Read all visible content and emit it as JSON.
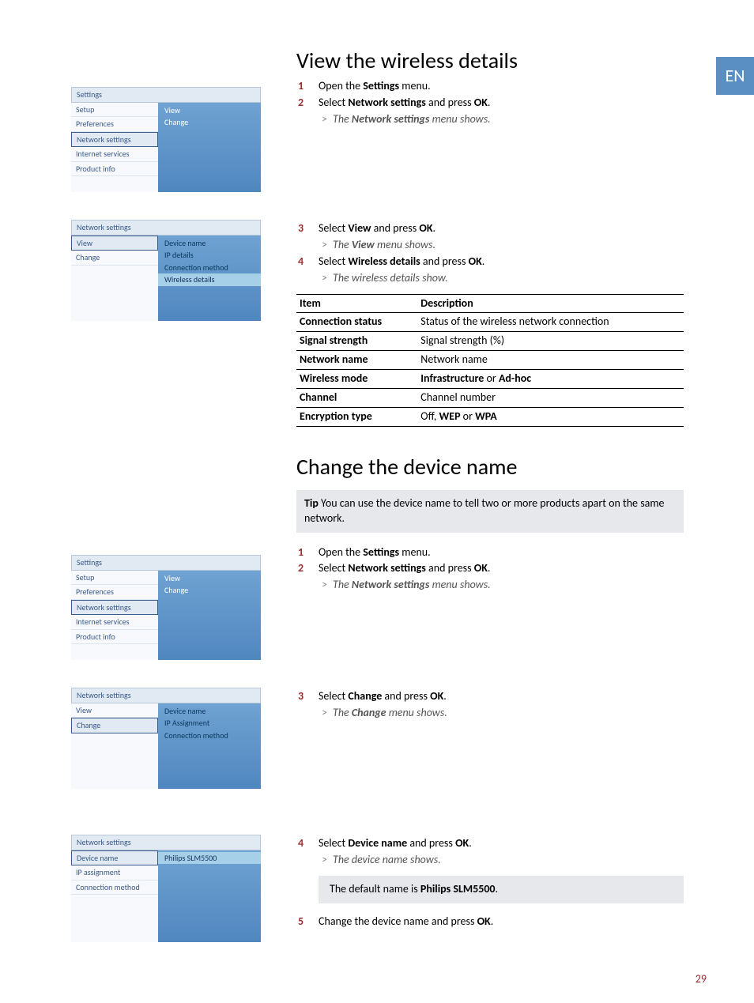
{
  "lang_tab": "EN",
  "page_number": "29",
  "section1": {
    "title": "View the wireless details",
    "steps": {
      "s1": "Open the Settings menu.",
      "s2a": "Select ",
      "s2b": "Network settings",
      "s2c": " and press ",
      "s2d": "OK",
      "s2e": ".",
      "r2a": "The ",
      "r2b": "Network settings",
      "r2c": " menu shows.",
      "s3a": "Select ",
      "s3b": "View",
      "s3c": " and press ",
      "s3d": "OK",
      "s3e": ".",
      "r3a": "The ",
      "r3b": "View",
      "r3c": " menu shows.",
      "s4a": "Select ",
      "s4b": "Wireless details",
      "s4c": " and press ",
      "s4d": "OK",
      "s4e": ".",
      "r4": "The wireless details show."
    },
    "table": {
      "h1": "Item",
      "h2": "Description",
      "rows": [
        {
          "a": "Connection status",
          "b": "Status of the wireless network connection",
          "abold": true
        },
        {
          "a": "Signal strength",
          "b": "Signal strength (%)",
          "abold": true
        },
        {
          "a": "Network name",
          "b": "Network name",
          "abold": true
        },
        {
          "a": "Wireless mode",
          "b": "Infrastructure or Ad-hoc",
          "abold": true,
          "bboldparts": true,
          "b1": "Infrastructure",
          "bmid": " or ",
          "b2": "Ad-hoc"
        },
        {
          "a": "Channel",
          "b": "Channel number",
          "abold": true
        },
        {
          "a": "Encryption type",
          "b": "Off, WEP or WPA",
          "abold": true,
          "bboldparts2": true,
          "b0": "Off, ",
          "b1": "WEP",
          "bmid": " or ",
          "b2": "WPA"
        }
      ]
    }
  },
  "section2": {
    "title": "Change the device name",
    "tip_label": "Tip",
    "tip_text": " You can use the device name to tell two or more products apart on the same network.",
    "steps": {
      "s1": "Open the Settings menu.",
      "s2a": "Select ",
      "s2b": "Network settings",
      "s2c": " and press ",
      "s2d": "OK",
      "s2e": ".",
      "r2a": "The ",
      "r2b": "Network settings",
      "r2c": " menu shows.",
      "s3a": "Select ",
      "s3b": "Change",
      "s3c": " and press ",
      "s3d": "OK",
      "s3e": ".",
      "r3a": "The ",
      "r3b": "Change",
      "r3c": " menu shows.",
      "s4a": "Select ",
      "s4b": "Device name",
      "s4c": " and press ",
      "s4d": "OK",
      "s4e": ".",
      "r4": "The device name shows.",
      "note_a": "The default name is ",
      "note_b": "Philips SLM5500",
      "note_c": ".",
      "s5a": "Change the device name and press ",
      "s5b": "OK",
      "s5c": "."
    }
  },
  "menus": {
    "settings_header": "Settings",
    "settings_items": [
      "Setup",
      "Preferences",
      "Network settings",
      "Internet services",
      "Product info"
    ],
    "settings_right": [
      "View",
      "Change"
    ],
    "ns_header": "Network settings",
    "ns_left": [
      "View",
      "Change"
    ],
    "ns_view_right": [
      "Device name",
      "IP details",
      "Connection method",
      "Wireless details"
    ],
    "ns_change_right": [
      "Device name",
      "IP Assignment",
      "Connection method"
    ],
    "dn_header": "Network settings",
    "dn_left": [
      "Device name",
      "IP assignment",
      "Connection method"
    ],
    "dn_right_value": "Philips SLM5500"
  }
}
